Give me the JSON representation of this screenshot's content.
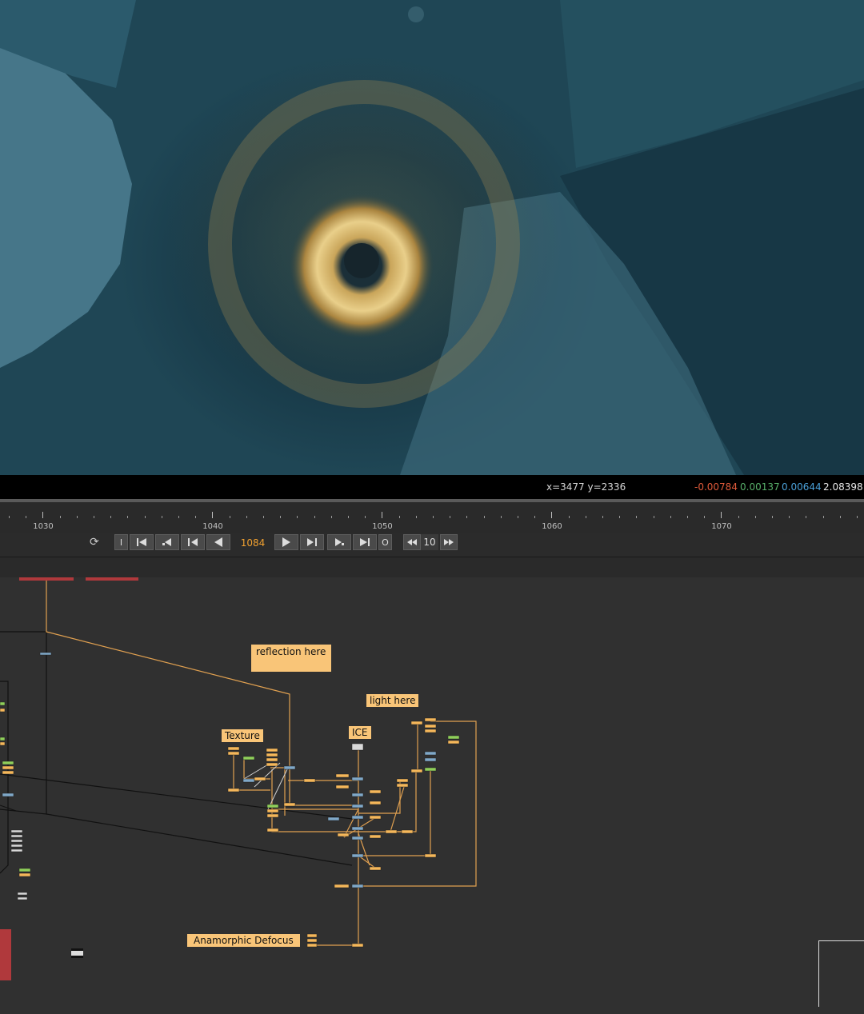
{
  "viewer": {
    "coords": "x=3477 y=2336",
    "pixel_values": {
      "r": "-0.00784",
      "g": "0.00137",
      "b": "0.00644",
      "a": "2.08398"
    },
    "colors": {
      "r": "#e05a3a",
      "g": "#58b06a",
      "b": "#4aa0d8",
      "a": "#e8e8e8"
    }
  },
  "timeline": {
    "tick_labels": [
      "1030",
      "1040",
      "1050",
      "1060",
      "1070"
    ]
  },
  "transport": {
    "loop_icon": "loop-mode-icon",
    "in_point_label": "I",
    "current_frame": "1084",
    "out_point_label": "O",
    "frame_increment": "10"
  },
  "node_graph": {
    "stickies": {
      "reflection": "reflection here",
      "light": "light here",
      "texture": "Texture",
      "ice": "ICE",
      "defocus": "Anamorphic Defocus"
    },
    "colors": {
      "sticky": "#f9c578",
      "node_orange": "#f5b75a",
      "node_green": "#8fcf5a",
      "node_blue": "#7fa8c8",
      "wire": "#e0a050",
      "red_node": "#b0393c"
    }
  }
}
